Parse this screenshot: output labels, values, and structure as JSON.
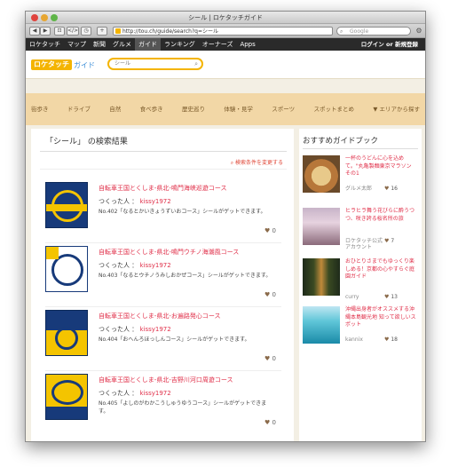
{
  "window": {
    "title": "シール | ロケタッチガイド"
  },
  "toolbar": {
    "url": "http://tou.ch/guide/search?q=シール",
    "search_placeholder": "Google",
    "btn_back": "◀",
    "btn_fwd": "▶",
    "btn_bookmarks": "⊡",
    "btn_tabs": "</>",
    "btn_history": "◷",
    "btn_add": "+"
  },
  "site_nav": {
    "items": [
      "ロケタッチ",
      "マップ",
      "新聞",
      "グルメ",
      "ガイド",
      "ランキング",
      "オーナーズ",
      "Apps"
    ],
    "login": "ログイン or 新規登録"
  },
  "header": {
    "logo_text": "ロケタッチ",
    "logo_sub": "ガイド",
    "search_value": "シール"
  },
  "categories": [
    "街歩き",
    "ドライブ",
    "自然",
    "食べ歩き",
    "歴史巡り",
    "体験・見学",
    "スポーツ",
    "スポットまとめ",
    "▼ エリアから探す"
  ],
  "results": {
    "heading": "「シール」 の検索結果",
    "condition_link": "検索条件を変更する",
    "author_label": "つくった人 ：",
    "items": [
      {
        "title": "自転車王国とくしま-県北-鳴門海峡巡遊コース",
        "author": "kissy1972",
        "desc": "No.402「なるとかいきょうずいおコース」シールがゲットできます。",
        "likes": "0"
      },
      {
        "title": "自転車王国とくしま-県北-鳴門ウチノ海潮風コース",
        "author": "kissy1972",
        "desc": "No.403「なるとウチノうみしおかぜコース」シールがゲットできます。",
        "likes": "0"
      },
      {
        "title": "自転車王国とくしま-県北-お遍路発心コース",
        "author": "kissy1972",
        "desc": "No.404「おへんろほっしんコース」シールがゲットできます。",
        "likes": "0"
      },
      {
        "title": "自転車王国とくしま-県北-吉野川河口周遊コース",
        "author": "kissy1972",
        "desc": "No.405「よしのがわかこうしゅうゆうコース」シールがゲットできます。",
        "likes": "0"
      }
    ]
  },
  "sidebar": {
    "title": "おすすめガイドブック",
    "books": [
      {
        "title": "一杯のうどんに心を込めて。\"丸亀製麺東京マラソン その1",
        "author": "グルメ太郎",
        "likes": "16"
      },
      {
        "title": "ヒラヒラ舞う花びらに酔うつつ、咲き誇る桜名所の旅",
        "author": "ロケタッチ公式アカウント",
        "likes": "7"
      },
      {
        "title": "おひとりさまでもゆっくり楽しめる！京都の心やすらぐ庭園ガイド",
        "author": "curry",
        "likes": "13"
      },
      {
        "title": "沖縄出身者がオススメする沖縄本島観光地 知って欲しいスポット",
        "author": "kannix",
        "likes": "18"
      }
    ]
  }
}
